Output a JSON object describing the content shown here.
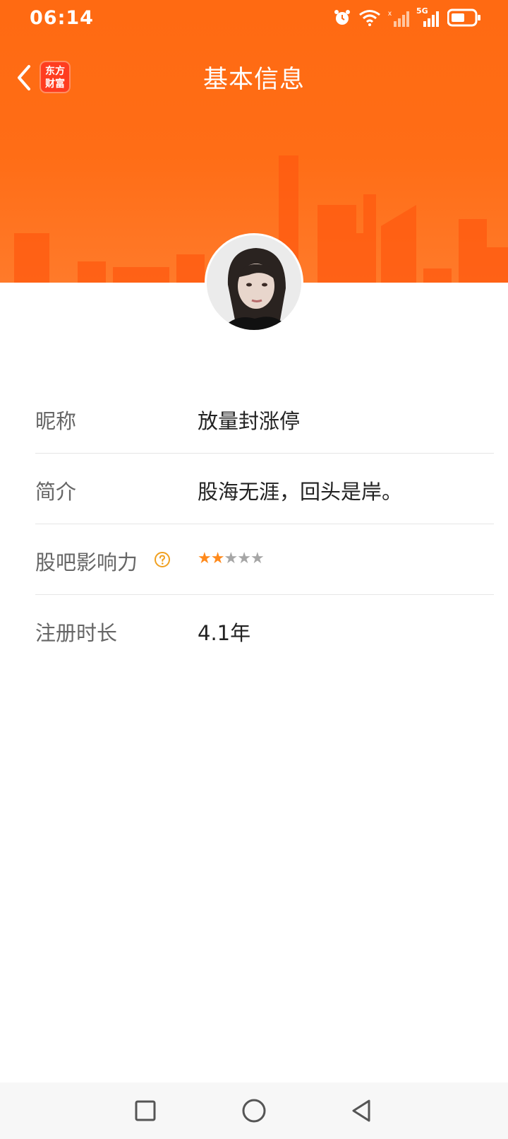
{
  "status_bar": {
    "time": "06:14",
    "network_label": "5G",
    "icons": [
      "alarm-icon",
      "wifi-icon",
      "signal-no-service-icon",
      "signal-5g-icon",
      "battery-icon"
    ]
  },
  "nav": {
    "title": "基本信息",
    "logo_line1": "东方",
    "logo_line2": "财富"
  },
  "profile": {
    "rows": [
      {
        "label": "昵称",
        "value": "放量封涨停"
      },
      {
        "label": "简介",
        "value": "股海无涯，回头是岸。"
      },
      {
        "label": "股吧影响力",
        "rating": 2,
        "rating_max": 5
      },
      {
        "label": "注册时长",
        "value": "4.1年"
      }
    ]
  },
  "stars": {
    "star_1": "★",
    "star_2": "★",
    "star_3": "★",
    "star_4": "★",
    "star_5": "★"
  },
  "colors": {
    "header_orange": "#ff6a12",
    "star_active": "#ff8a1c",
    "star_inactive": "#a6a6a6",
    "help_icon": "#f0a020"
  },
  "system_nav": [
    "recent-apps-button",
    "home-button",
    "back-button"
  ]
}
